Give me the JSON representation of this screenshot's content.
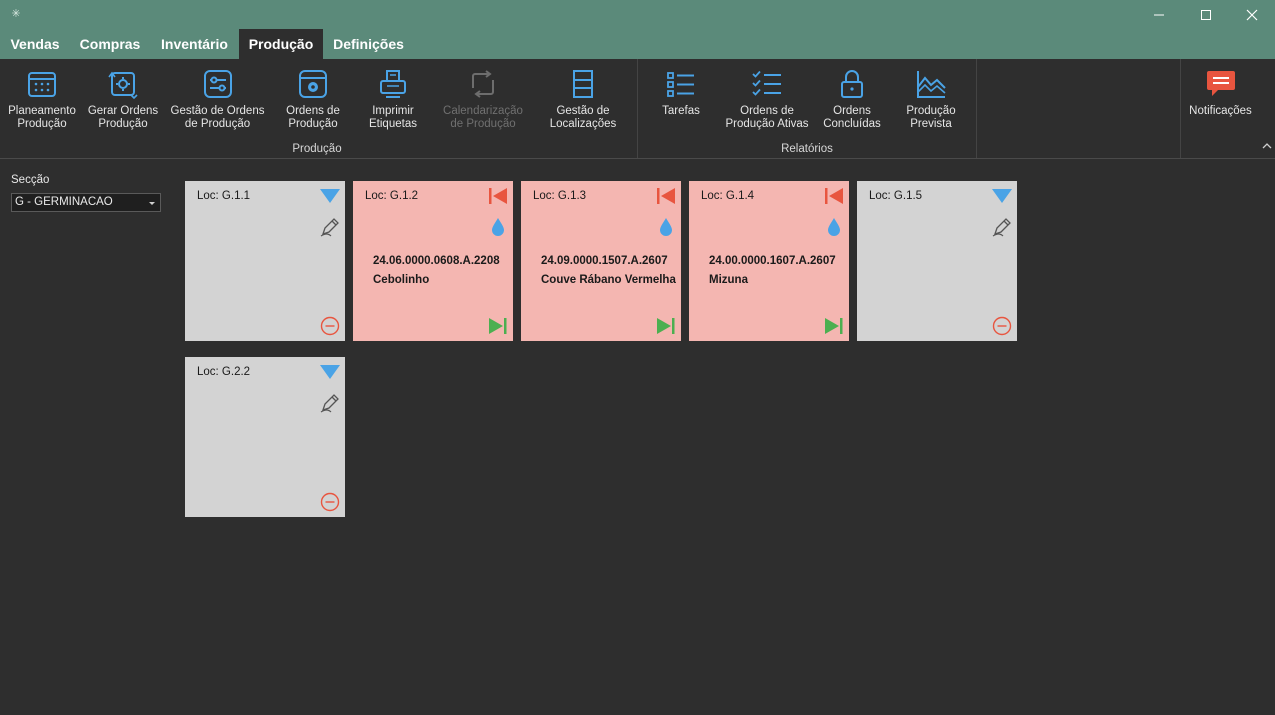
{
  "window": {
    "logo_icon": "app-logo-icon",
    "minimize_icon": "minimize-icon",
    "maximize_icon": "maximize-icon",
    "close_icon": "close-icon"
  },
  "tabs": [
    {
      "label": "Vendas"
    },
    {
      "label": "Compras"
    },
    {
      "label": "Inventário"
    },
    {
      "label": "Produção",
      "active": true
    },
    {
      "label": "Definições"
    }
  ],
  "ribbon": {
    "producao_group": "Produção",
    "relatorios_group": "Relatórios",
    "buttons": [
      {
        "label": "Planeamento\nProdução",
        "icon": "calendar-icon"
      },
      {
        "label": "Gerar Ordens\nProdução",
        "icon": "generate-orders-icon"
      },
      {
        "label": "Gestão de Ordens\nde Produção",
        "icon": "sliders-icon"
      },
      {
        "label": "Ordens de\nProdução",
        "icon": "production-orders-icon"
      },
      {
        "label": "Imprimir\nEtiquetas",
        "icon": "printer-icon"
      },
      {
        "label": "Calendarização\nde Produção",
        "icon": "schedule-icon",
        "disabled": true
      },
      {
        "label": "Gestão de\nLocalizações",
        "icon": "shelf-icon"
      },
      {
        "label": "Tarefas",
        "icon": "task-list-icon"
      },
      {
        "label": "Ordens de\nProdução Ativas",
        "icon": "checklist-icon"
      },
      {
        "label": "Ordens\nConcluídas",
        "icon": "lock-icon"
      },
      {
        "label": "Produção\nPrevista",
        "icon": "area-chart-icon"
      },
      {
        "label": "Notificações",
        "icon": "notification-icon"
      }
    ]
  },
  "sidebar": {
    "section_label": "Secção",
    "section_value": "G - GERMINACAO"
  },
  "colors": {
    "header": "#5b8a7a",
    "background": "#2e2e2e",
    "card_empty": "#d3d3d3",
    "card_filled": "#f4b6b1",
    "accent_blue": "#4aa3e6",
    "red": "#e8553f",
    "green": "#4caf50"
  },
  "locations": [
    {
      "loc": "Loc: G.1.1",
      "status": "empty"
    },
    {
      "loc": "Loc: G.1.2",
      "status": "occupied",
      "code": "24.06.0000.0608.A.2208",
      "name": "Cebolinho"
    },
    {
      "loc": "Loc: G.1.3",
      "status": "occupied",
      "code": "24.09.0000.1507.A.2607",
      "name": "Couve Rábano Vermelha"
    },
    {
      "loc": "Loc: G.1.4",
      "status": "occupied",
      "code": "24.00.0000.1607.A.2607",
      "name": "Mizuna"
    },
    {
      "loc": "Loc: G.1.5",
      "status": "empty"
    },
    {
      "loc": "Loc: G.2.2",
      "status": "empty"
    }
  ]
}
